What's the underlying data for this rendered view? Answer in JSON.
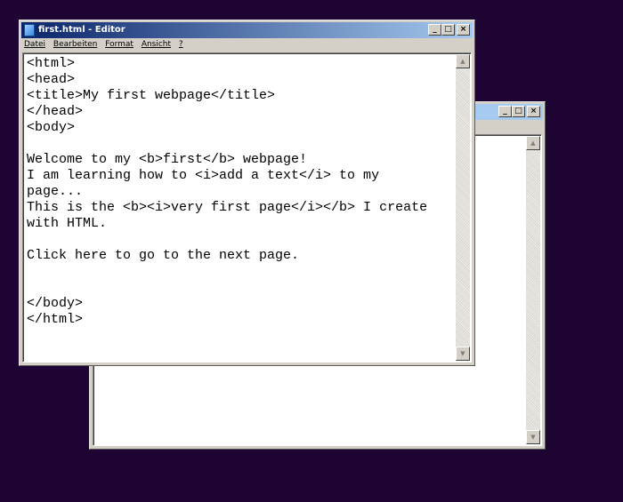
{
  "back_window": {
    "title": "",
    "buttons": {
      "minimize": "_",
      "maximize": "□",
      "close": "×"
    },
    "scroll_up": "▲",
    "scroll_down": "▼"
  },
  "front_window": {
    "title": "first.html - Editor",
    "buttons": {
      "minimize": "_",
      "maximize": "□",
      "close": "×"
    },
    "menu": [
      "Datei",
      "Bearbeiten",
      "Format",
      "Ansicht",
      "?"
    ],
    "lines": [
      "<html>",
      "<head>",
      "<title>My first webpage</title>",
      "</head>",
      "<body>",
      "",
      "Welcome to my <b>first</b> webpage!",
      "I am learning how to <i>add a text</i> to my",
      "page...",
      "This is the <b><i>very first page</i></b> I create",
      "with HTML.",
      "",
      "Click here to go to the next page.",
      "",
      "",
      "</body>",
      "</html>"
    ],
    "scroll_up": "▲",
    "scroll_down": "▼"
  }
}
